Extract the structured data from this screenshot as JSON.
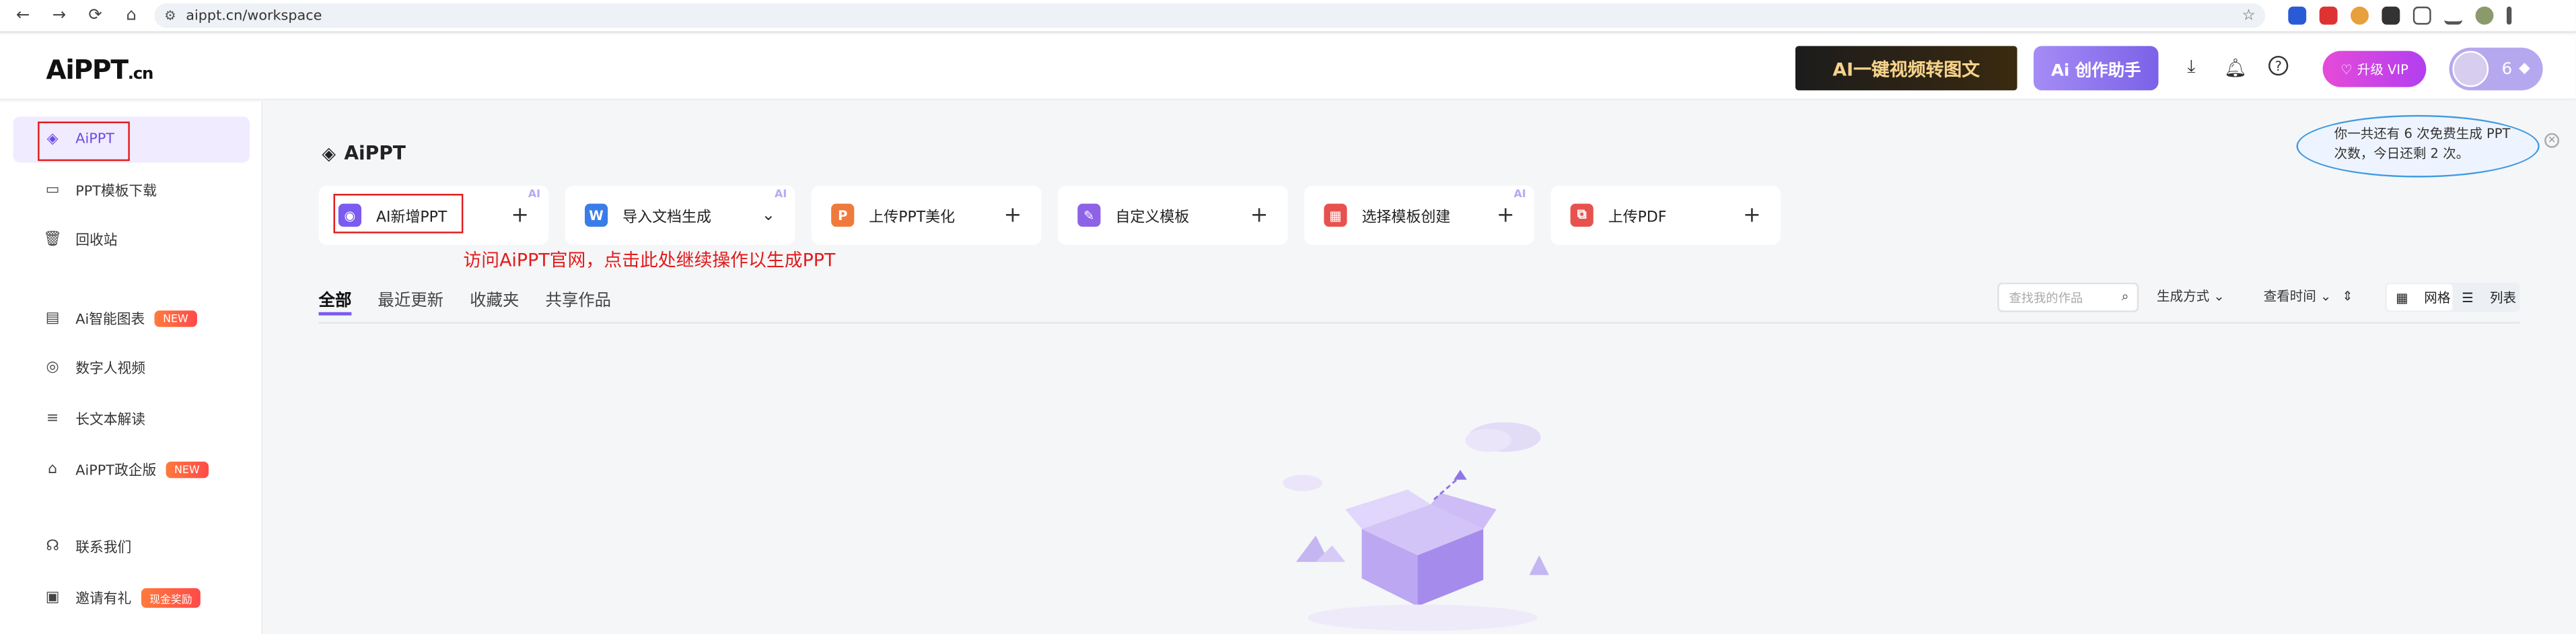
{
  "browser": {
    "url": "aippt.cn/workspace",
    "back": "←",
    "forward": "→",
    "reload": "⟳",
    "home": "⌂"
  },
  "header": {
    "logo": "AiPPT",
    "logo_suffix": ".cn",
    "banner_video": "AI一键视频转图文",
    "banner_assistant": "Ai 创作助手",
    "vip_label": "升级 VIP",
    "user_count": "6"
  },
  "sidebar": {
    "items": [
      {
        "label": "AiPPT",
        "icon": "layers-icon"
      },
      {
        "label": "PPT模板下载",
        "icon": "ppt-template-icon"
      },
      {
        "label": "回收站",
        "icon": "trash-icon"
      },
      {
        "label": "Ai智能图表",
        "icon": "chart-icon",
        "badge": "NEW"
      },
      {
        "label": "数字人视频",
        "icon": "digital-human-icon"
      },
      {
        "label": "长文本解读",
        "icon": "long-text-icon"
      },
      {
        "label": "AiPPT政企版",
        "icon": "enterprise-icon",
        "badge": "NEW"
      },
      {
        "label": "联系我们",
        "icon": "headset-icon"
      },
      {
        "label": "邀请有礼",
        "icon": "gift-icon",
        "badge": "现金奖励"
      }
    ]
  },
  "main": {
    "title": "AiPPT",
    "cards": [
      {
        "label": "AI新增PPT",
        "ai": "AI",
        "action": "+"
      },
      {
        "label": "导入文档生成",
        "ai": "AI",
        "action": "⌄"
      },
      {
        "label": "上传PPT美化",
        "ai": "",
        "action": "+"
      },
      {
        "label": "自定义模板",
        "ai": "",
        "action": "+"
      },
      {
        "label": "选择模板创建",
        "ai": "AI",
        "action": "+"
      },
      {
        "label": "上传PDF",
        "ai": "",
        "action": "+"
      }
    ],
    "annotation": "访问AiPPT官网，点击此处继续操作以生成PPT",
    "tabs": [
      "全部",
      "最近更新",
      "收藏夹",
      "共享作品"
    ],
    "search_placeholder": "查找我的作品",
    "filter_generate": "生成方式",
    "filter_time": "查看时间",
    "view_grid": "网格",
    "view_list": "列表"
  },
  "tooltip": {
    "text": "你一共还有 6 次免费生成 PPT 次数，今日还剩 2 次。"
  },
  "colors": {
    "accent": "#7b5bf0",
    "annotation_red": "#e21b1b",
    "vip_gradient_start": "#e64bd8",
    "badge_orange": "#ff6a3c"
  }
}
